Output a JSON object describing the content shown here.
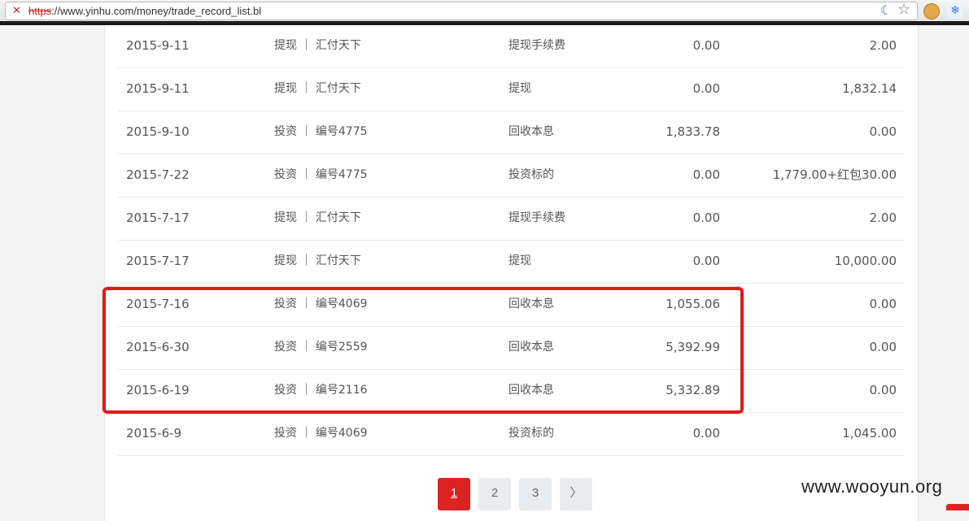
{
  "browser": {
    "url_protocol": "https",
    "url_rest": "://www.yinhu.com/money/trade_record_list.bl",
    "insecure_icon": "insecure-lock-icon"
  },
  "records": [
    {
      "date": "2015-9-11",
      "type": "提现 ｜ 汇付天下",
      "desc": "提现手续费",
      "income": "0.00",
      "expense": "2.00"
    },
    {
      "date": "2015-9-11",
      "type": "提现 ｜ 汇付天下",
      "desc": "提现",
      "income": "0.00",
      "expense": "1,832.14"
    },
    {
      "date": "2015-9-10",
      "type": "投资 ｜ 编号4775",
      "desc": "回收本息",
      "income": "1,833.78",
      "expense": "0.00"
    },
    {
      "date": "2015-7-22",
      "type": "投资 ｜ 编号4775",
      "desc": "投资标的",
      "income": "0.00",
      "expense": "1,779.00+红包30.00"
    },
    {
      "date": "2015-7-17",
      "type": "提现 ｜ 汇付天下",
      "desc": "提现手续费",
      "income": "0.00",
      "expense": "2.00"
    },
    {
      "date": "2015-7-17",
      "type": "提现 ｜ 汇付天下",
      "desc": "提现",
      "income": "0.00",
      "expense": "10,000.00"
    },
    {
      "date": "2015-7-16",
      "type": "投资 ｜ 编号4069",
      "desc": "回收本息",
      "income": "1,055.06",
      "expense": "0.00"
    },
    {
      "date": "2015-6-30",
      "type": "投资 ｜ 编号2559",
      "desc": "回收本息",
      "income": "5,392.99",
      "expense": "0.00"
    },
    {
      "date": "2015-6-19",
      "type": "投资 ｜ 编号2116",
      "desc": "回收本息",
      "income": "5,332.89",
      "expense": "0.00"
    },
    {
      "date": "2015-6-9",
      "type": "投资 ｜ 编号4069",
      "desc": "投资标的",
      "income": "0.00",
      "expense": "1,045.00"
    }
  ],
  "pagination": {
    "pages": [
      "1",
      "2",
      "3"
    ],
    "current": "1",
    "next_label": "〉"
  },
  "watermark": "www.wooyun.org",
  "colors": {
    "accent": "#dd2222",
    "highlight_box": "#e01b1b"
  }
}
